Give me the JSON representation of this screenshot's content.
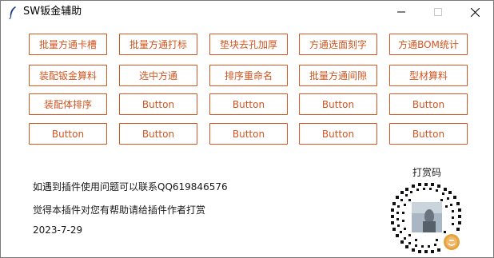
{
  "window": {
    "title": "SW钣金辅助"
  },
  "buttons": [
    {
      "id": "btn-1",
      "label": "批量方通卡槽"
    },
    {
      "id": "btn-2",
      "label": "批量方通打标"
    },
    {
      "id": "btn-3",
      "label": "垫块去孔加厚"
    },
    {
      "id": "btn-4",
      "label": "方通选面刻字"
    },
    {
      "id": "btn-5",
      "label": "方通BOM统计"
    },
    {
      "id": "btn-6",
      "label": "装配钣金算料"
    },
    {
      "id": "btn-7",
      "label": "选中方通"
    },
    {
      "id": "btn-8",
      "label": "排序重命名"
    },
    {
      "id": "btn-9",
      "label": "批量方通间隙"
    },
    {
      "id": "btn-10",
      "label": "型材算料"
    },
    {
      "id": "btn-11",
      "label": "装配体排序"
    },
    {
      "id": "btn-12",
      "label": "Button"
    },
    {
      "id": "btn-13",
      "label": "Button"
    },
    {
      "id": "btn-14",
      "label": "Button"
    },
    {
      "id": "btn-15",
      "label": "Button"
    },
    {
      "id": "btn-16",
      "label": "Button"
    },
    {
      "id": "btn-17",
      "label": "Button"
    },
    {
      "id": "btn-18",
      "label": "Button"
    },
    {
      "id": "btn-19",
      "label": "Button"
    },
    {
      "id": "btn-20",
      "label": "Button"
    }
  ],
  "info": {
    "contact": "如遇到插件使用问题可以联系QQ619846576",
    "tip": "觉得本插件对您有帮助请给插件作者打赏",
    "date": "2023-7-29"
  },
  "qr": {
    "label": "打赏码"
  },
  "colors": {
    "accent": "#d2541f"
  }
}
